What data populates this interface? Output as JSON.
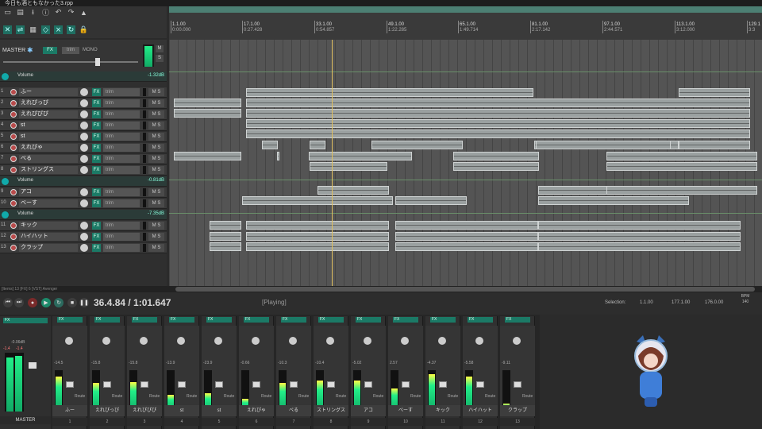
{
  "window": {
    "title": "今日も酒ともなかった3.rpp"
  },
  "toolbar": {
    "icons": [
      "new-icon",
      "open-icon",
      "save-icon",
      "info-icon",
      "undo-icon",
      "redo-icon",
      "metronome-icon",
      "snap-icon",
      "ripple-icon",
      "grid-icon",
      "loop-icon",
      "lock-icon",
      "envelope-icon",
      "auto-crossfade-icon"
    ]
  },
  "ruler": {
    "marks": [
      {
        "bar": "1.1.00",
        "time": "0:00.000"
      },
      {
        "bar": "17.1.00",
        "time": "0:27.428"
      },
      {
        "bar": "33.1.00",
        "time": "0:54.857"
      },
      {
        "bar": "49.1.00",
        "time": "1:22.285"
      },
      {
        "bar": "65.1.00",
        "time": "1:49.714"
      },
      {
        "bar": "81.1.00",
        "time": "2:17.142"
      },
      {
        "bar": "97.1.00",
        "time": "2:44.571"
      },
      {
        "bar": "113.1.00",
        "time": "3:12.000"
      },
      {
        "bar": "129.1",
        "time": "3:3"
      }
    ]
  },
  "master": {
    "label": "MASTER",
    "fx": "FX",
    "trim": "trim",
    "mono": "MONO",
    "volume_label": "Volume",
    "volume_db": "-1.32dB"
  },
  "tracks": [
    {
      "num": "1",
      "name": "ふー"
    },
    {
      "num": "2",
      "name": "えれぴっぴ"
    },
    {
      "num": "3",
      "name": "えれぴぴぴ"
    },
    {
      "num": "4",
      "name": "st"
    },
    {
      "num": "5",
      "name": "st"
    },
    {
      "num": "6",
      "name": "えれぴゃ"
    },
    {
      "num": "7",
      "name": "べる"
    },
    {
      "num": "8",
      "name": "ストリングス"
    },
    {
      "num": "9",
      "name": "アコ"
    },
    {
      "num": "10",
      "name": "べーす"
    },
    {
      "num": "11",
      "name": "キック"
    },
    {
      "num": "12",
      "name": "ハイハット"
    },
    {
      "num": "13",
      "name": "クラップ"
    }
  ],
  "folders": [
    {
      "label": "Volume",
      "db": "-0.81dB"
    },
    {
      "label": "Volume",
      "db": "-7.35dB"
    }
  ],
  "track_controls": {
    "fx": "FX",
    "trim": "trim",
    "ms": "M S"
  },
  "transport": {
    "time": "36.4.84 / 1:01.647",
    "state": "[Playing]",
    "selection_label": "Selection:",
    "sel_start": "1.1.00",
    "sel_end": "177.1.00",
    "sel_len": "176.0.00",
    "bpm_label": "BPM",
    "bpm": "140",
    "sig": "4/4"
  },
  "status_strip": "[Items] 13 [FX] 6 [VST] Avenger",
  "mixer": {
    "master_label": "MASTER",
    "master_db": "-0.06dB",
    "master_peaks": [
      "-1.4",
      "-1.4"
    ],
    "strips": [
      {
        "name": "ふー",
        "idx": "1",
        "db": "-14.5"
      },
      {
        "name": "えれぴっぴ",
        "idx": "2",
        "db": "-15.8"
      },
      {
        "name": "えれぴぴぴ",
        "idx": "3",
        "db": "-15.8"
      },
      {
        "name": "st",
        "idx": "4",
        "db": "-13.9"
      },
      {
        "name": "st",
        "idx": "5",
        "db": "-23.9"
      },
      {
        "name": "えれぴゃ",
        "idx": "6",
        "db": "-0.66"
      },
      {
        "name": "べる",
        "idx": "7",
        "db": "-10.3"
      },
      {
        "name": "ストリングス",
        "idx": "8",
        "db": "-10.4"
      },
      {
        "name": "アコ",
        "idx": "9",
        "db": "-5.02"
      },
      {
        "name": "べーす",
        "idx": "10",
        "db": "2.57"
      },
      {
        "name": "キック",
        "idx": "11",
        "db": "-4.37"
      },
      {
        "name": "ハイハット",
        "idx": "12",
        "db": "-5.58"
      },
      {
        "name": "クラップ",
        "idx": "13",
        "db": "-9.11"
      }
    ],
    "fx": "FX",
    "route": "Route"
  },
  "colors": {
    "accent": "#1b7a66",
    "item": "#9aa0a0",
    "bg": "#2b2b2b",
    "cursor": "#e0c060"
  }
}
